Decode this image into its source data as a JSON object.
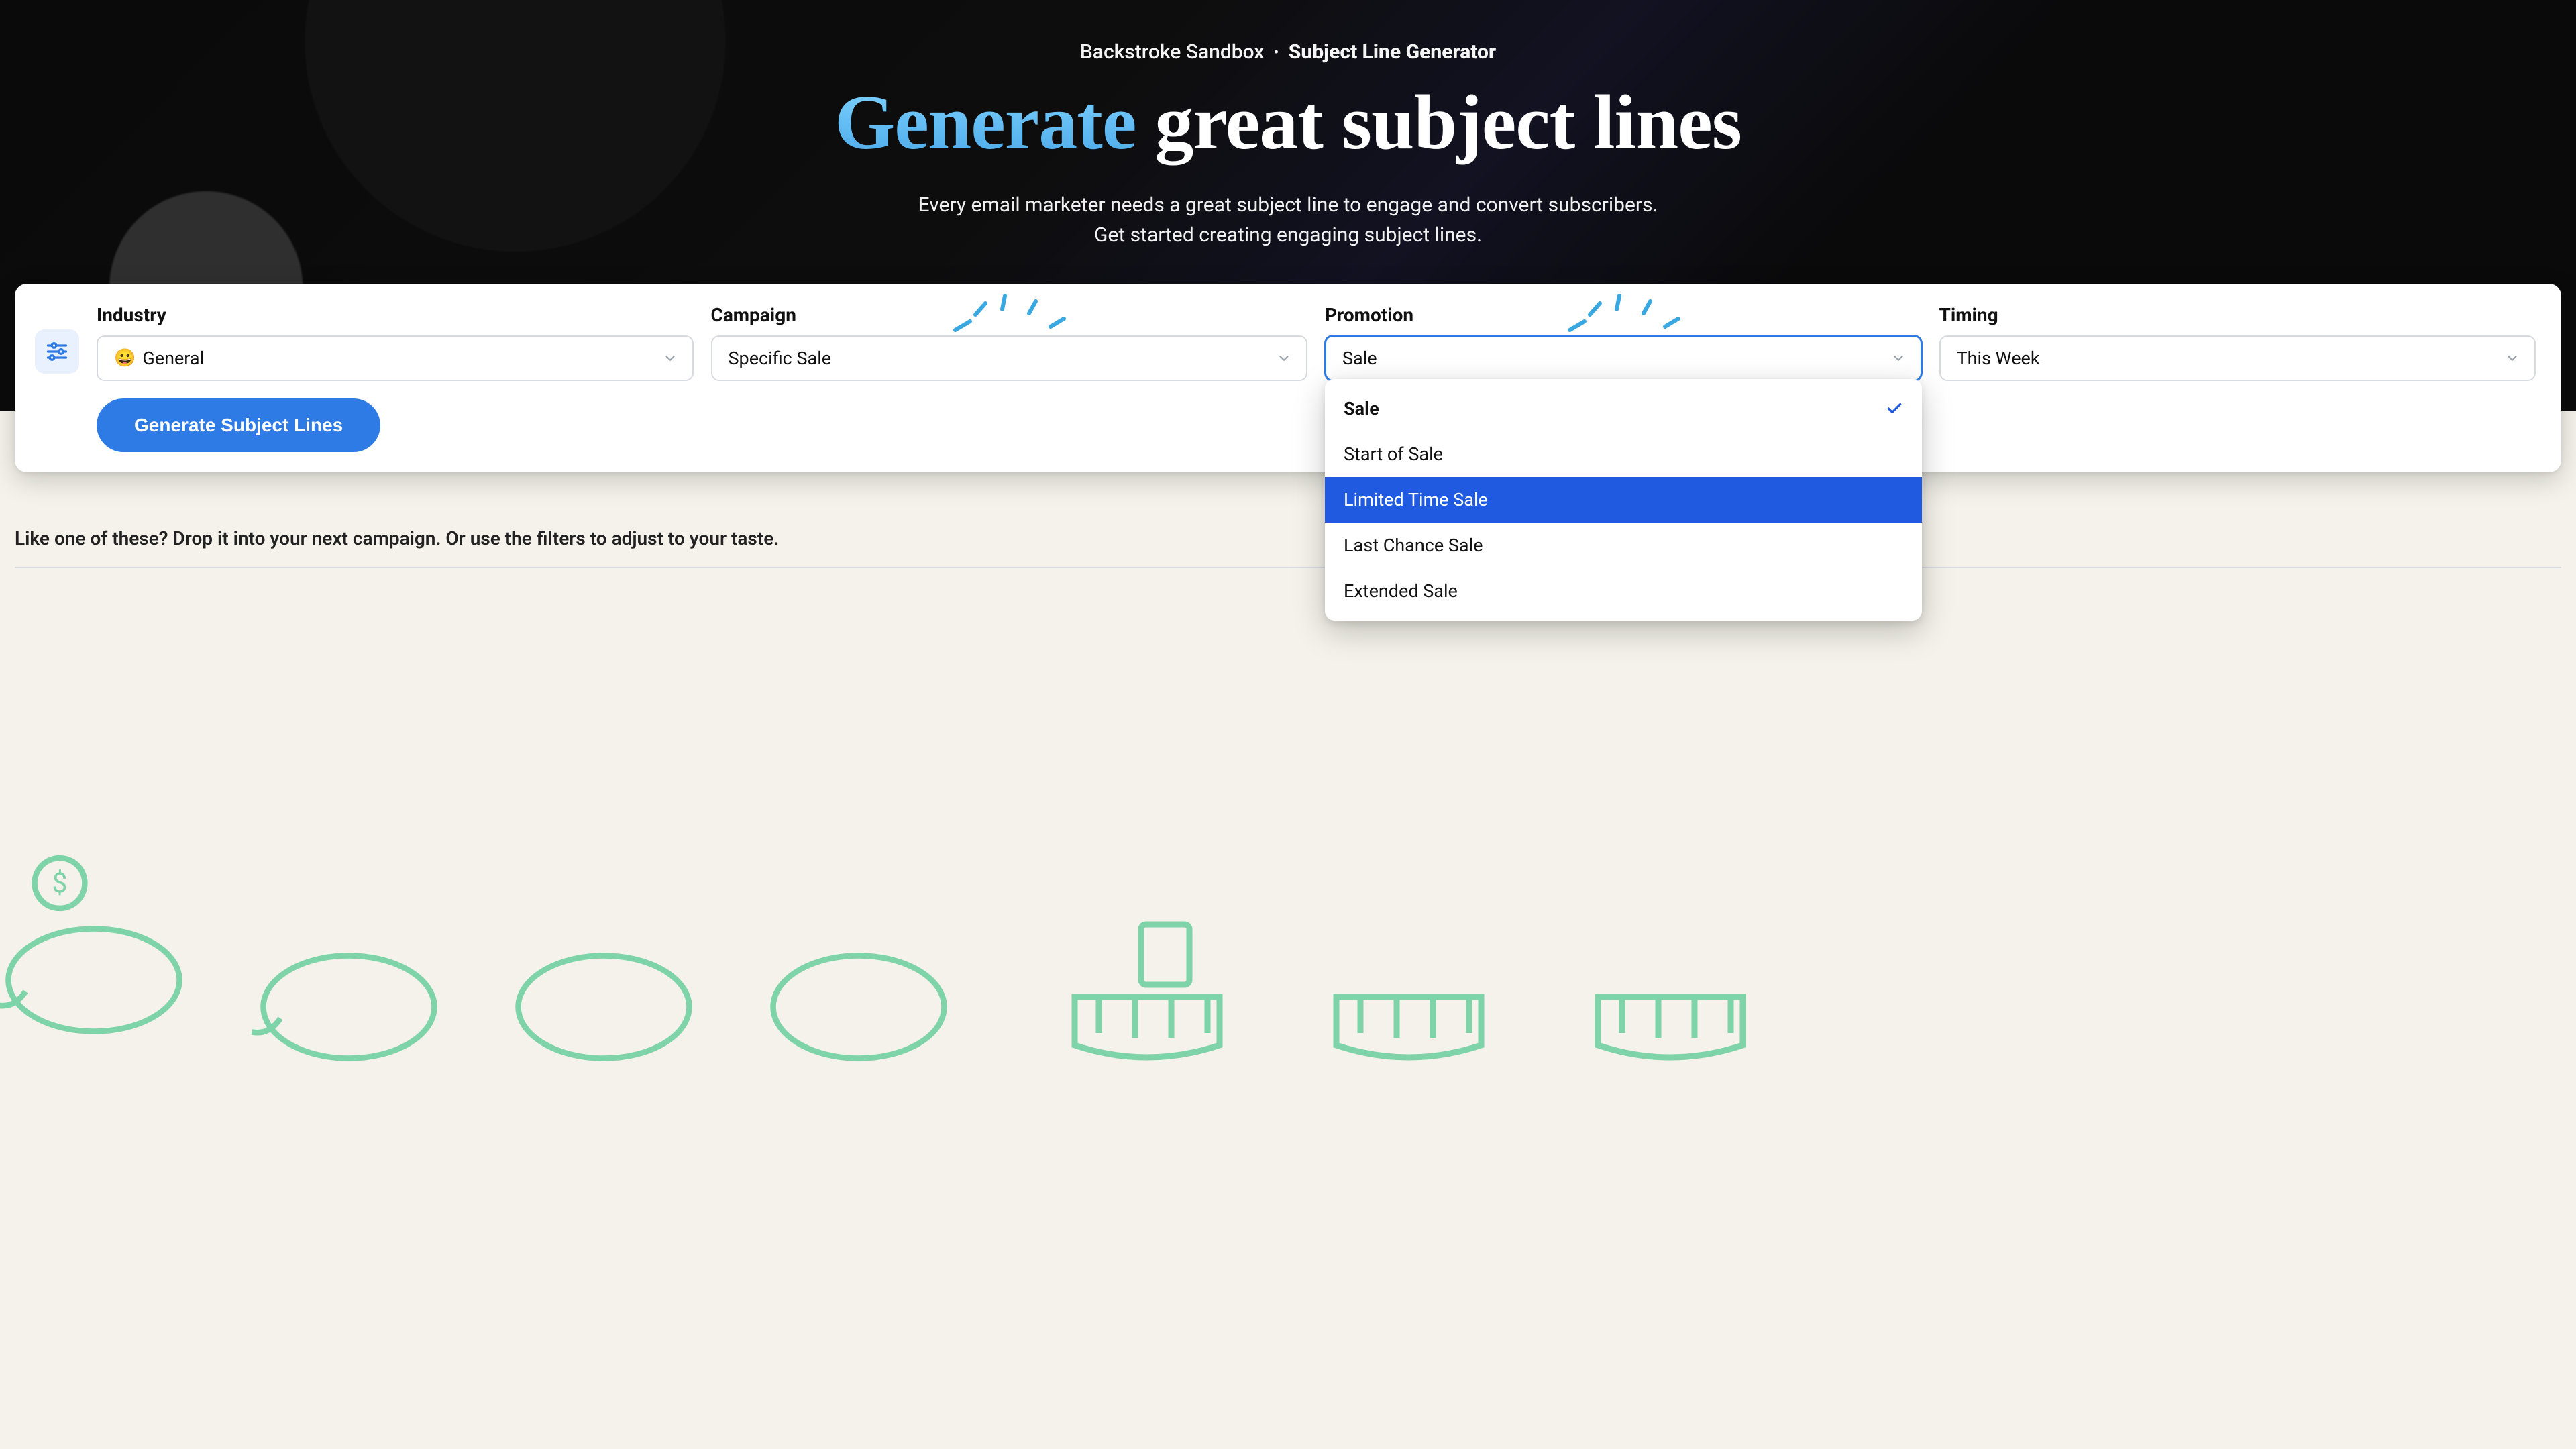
{
  "crumb": {
    "app": "Backstroke Sandbox",
    "page": "Subject Line Generator"
  },
  "headline": {
    "accent": "Generate",
    "rest": "great subject lines"
  },
  "sub": {
    "line1": "Every email marketer needs a great subject line to engage and convert subscribers.",
    "line2": "Get started creating engaging subject lines."
  },
  "fields": {
    "industry": {
      "label": "Industry",
      "emoji": "😀",
      "value": "General"
    },
    "campaign": {
      "label": "Campaign",
      "value": "Specific Sale"
    },
    "promotion": {
      "label": "Promotion",
      "value": "Sale",
      "options": [
        "Sale",
        "Start of Sale",
        "Limited Time Sale",
        "Last Chance Sale",
        "Extended Sale"
      ],
      "selected_index": 0,
      "hover_index": 2
    },
    "timing": {
      "label": "Timing",
      "value": "This Week"
    }
  },
  "buttons": {
    "generate": "Generate Subject Lines"
  },
  "helper": "Like one of these? Drop it into your next campaign. Or use the filters to adjust to your taste."
}
